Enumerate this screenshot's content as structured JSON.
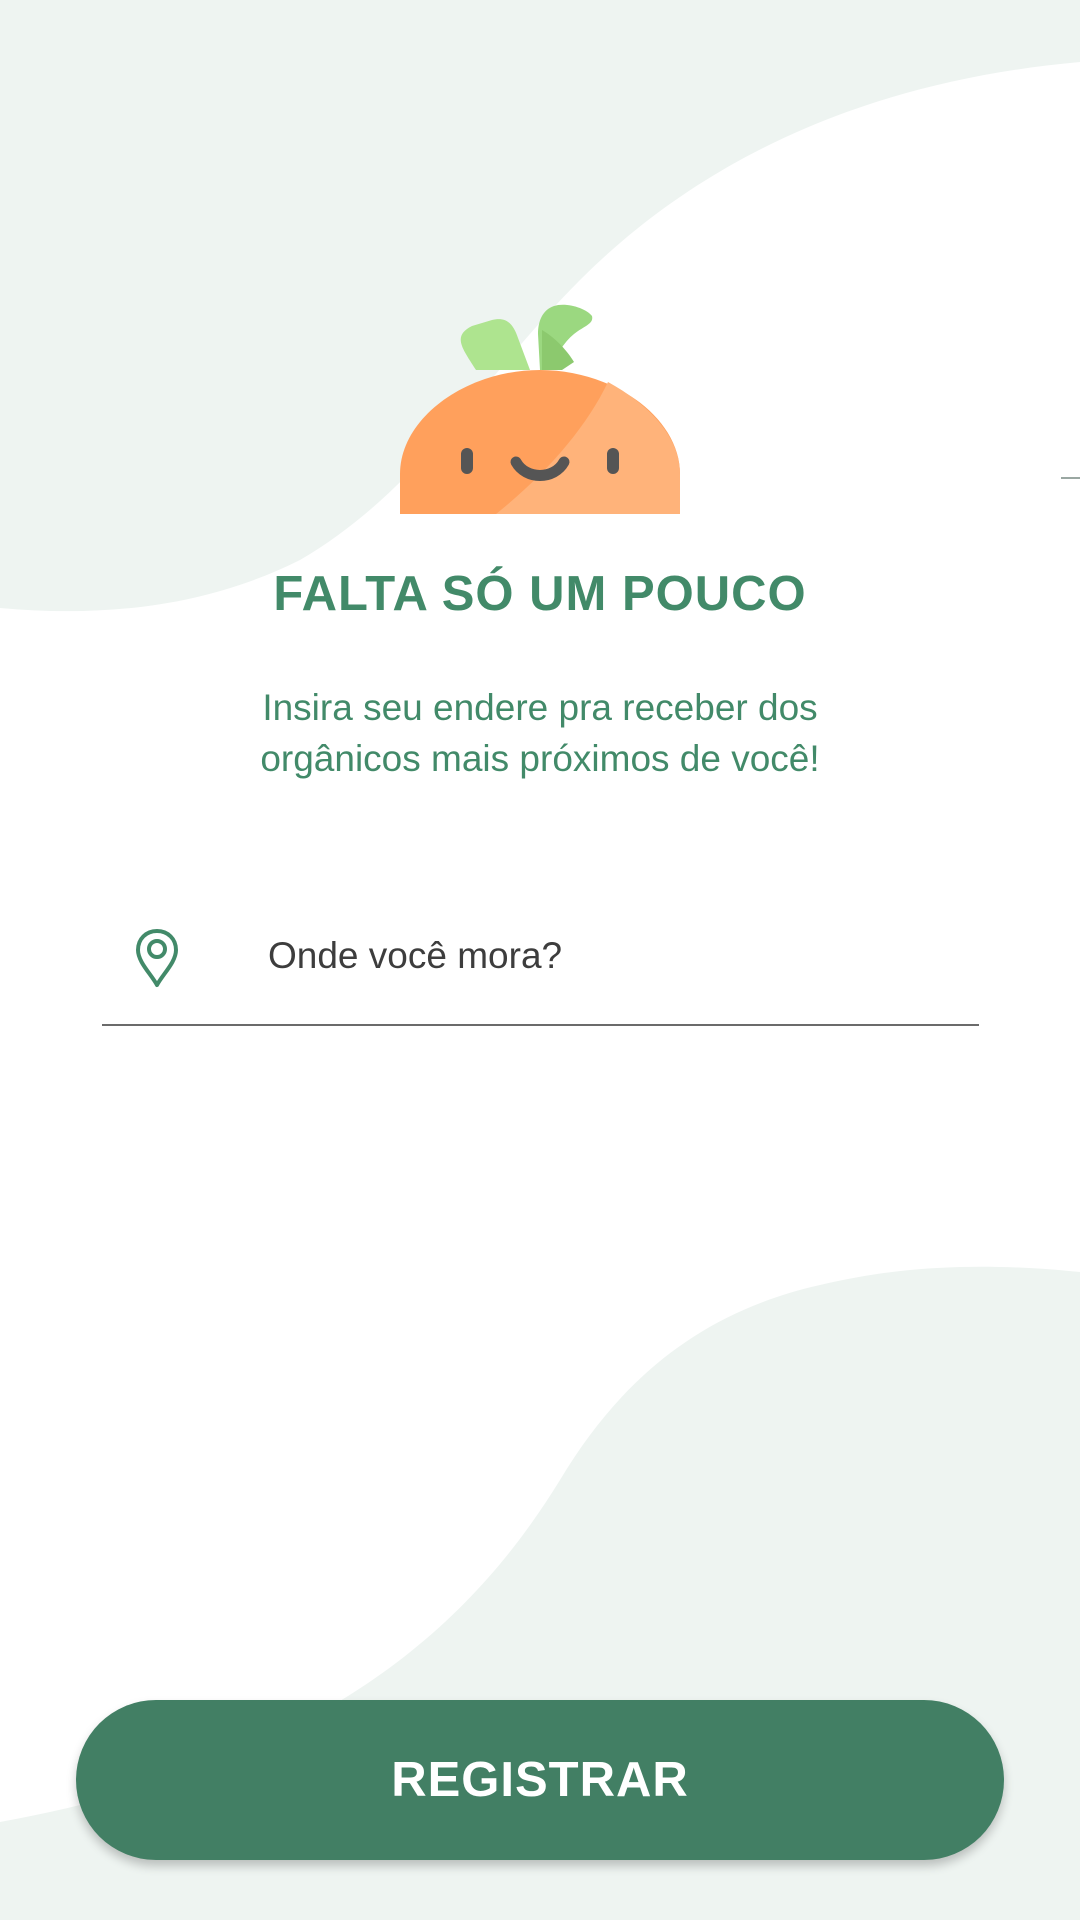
{
  "app": {
    "title": "FALTA SÓ UM POUCO",
    "subtitle": "Insira seu endere pra receber dos\norgânicos mais  próximos de você!"
  },
  "address_field": {
    "placeholder": "Onde você mora?",
    "value": "",
    "icon": "location-pin-icon"
  },
  "register_button": {
    "label": "REGISTRAR"
  },
  "mascot": {
    "icon": "carrot-mascot-icon"
  },
  "colors": {
    "primary_green": "#428a69",
    "button_green": "#427f64",
    "background_blob": "#eef4f1",
    "carrot_orange": "#ffa05c",
    "carrot_orange_light": "#ffb37a",
    "leaf_light": "#aee48f",
    "leaf_dark": "#8cc96e",
    "face": "#555555"
  }
}
